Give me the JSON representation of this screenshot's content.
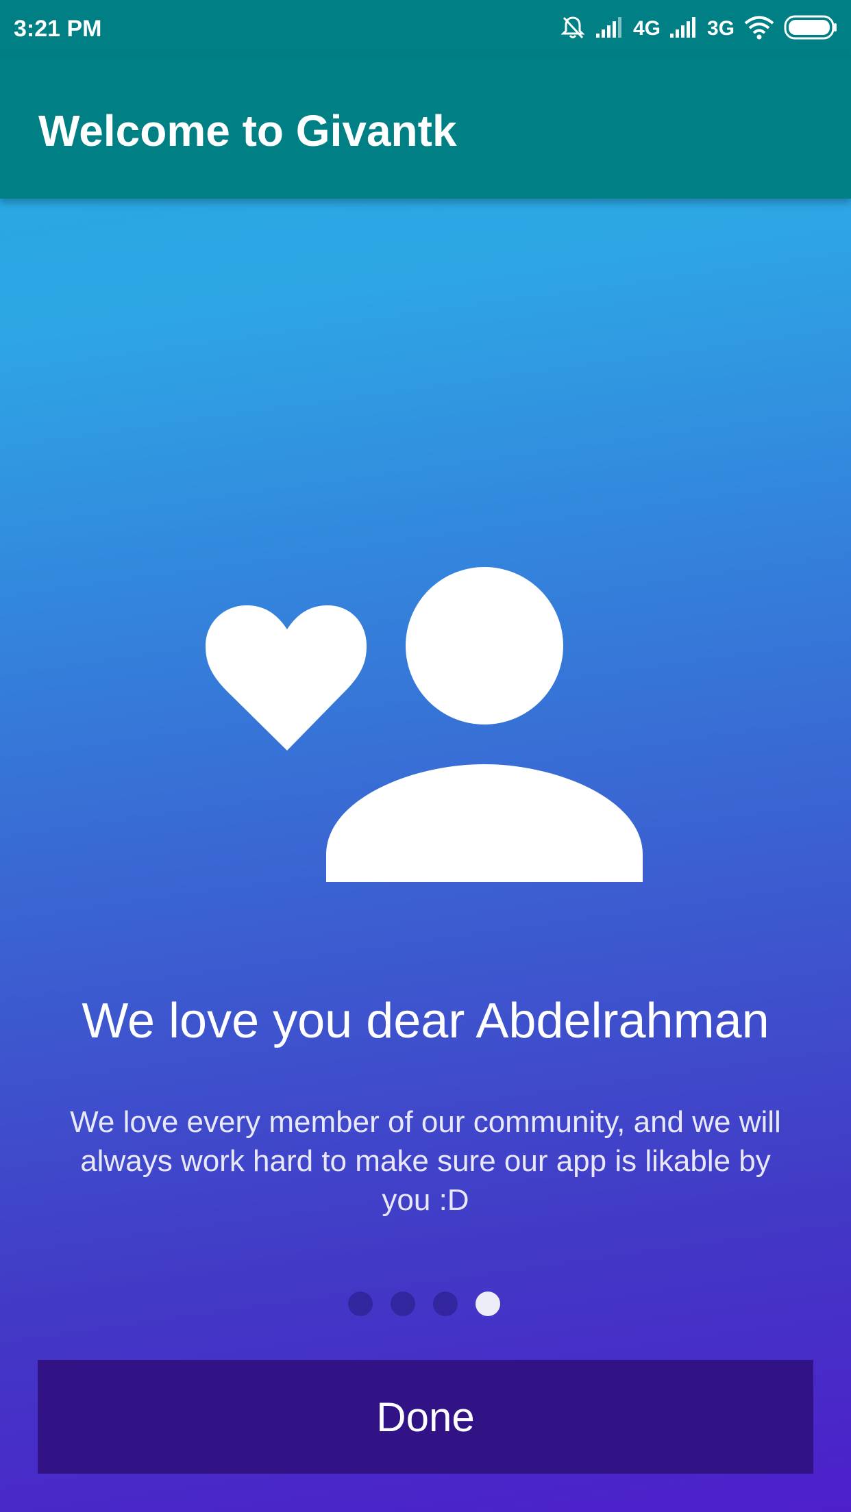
{
  "status_bar": {
    "time": "3:21 PM",
    "network_1": "4G",
    "network_2": "3G"
  },
  "app_bar": {
    "title": "Welcome to Givantk"
  },
  "slide": {
    "icon": "favorite-user-icon",
    "headline": "We love you dear Abdelrahman",
    "description": "We love every member of our community, and we will always work hard to make sure our app is likable by you :D",
    "page_count": 4,
    "active_page": 4
  },
  "footer": {
    "done_label": "Done"
  },
  "colors": {
    "app_bar": "#008084",
    "gradient_top": "#29a8e3",
    "gradient_bottom": "#4d1fca",
    "done_button": "#321385"
  }
}
